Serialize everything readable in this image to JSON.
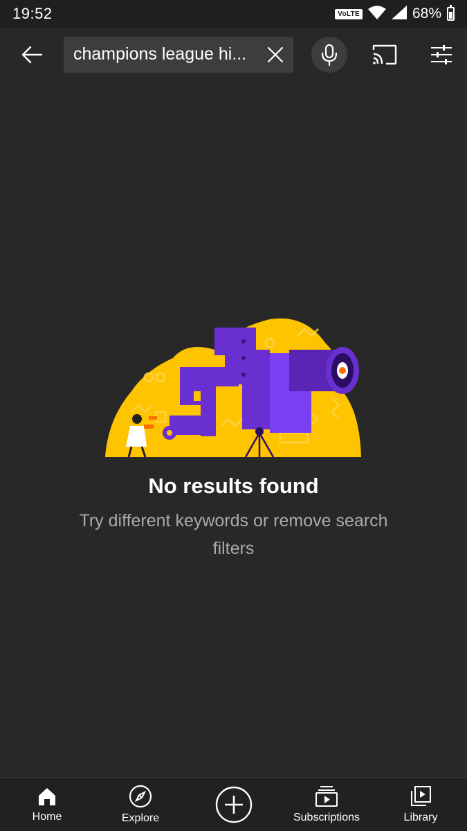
{
  "status_bar": {
    "time": "19:52",
    "network_badge": "VoLTE",
    "battery": "68%",
    "icons": [
      "wifi-icon",
      "signal-icon",
      "battery-icon"
    ]
  },
  "search": {
    "query": "champions league hi...",
    "icons": {
      "back": "back-arrow-icon",
      "clear": "close-icon",
      "mic": "microphone-icon",
      "cast": "cast-icon",
      "filter": "filter-sliders-icon"
    }
  },
  "empty_state": {
    "title": "No results found",
    "subtitle": "Try different keywords or remove search filters",
    "illustration": "telescope-illustration"
  },
  "bottom_nav": {
    "items": [
      {
        "label": "Home",
        "icon": "home-icon"
      },
      {
        "label": "Explore",
        "icon": "compass-icon"
      },
      {
        "label": "",
        "icon": "create-plus-icon"
      },
      {
        "label": "Subscriptions",
        "icon": "subscriptions-icon"
      },
      {
        "label": "Library",
        "icon": "library-icon"
      }
    ]
  },
  "colors": {
    "background": "#282828",
    "status_bar": "#1f1f1f",
    "search_field": "#3d3d3d",
    "illustration_yellow": "#ffc400",
    "illustration_purple": "#6a2fd0",
    "accent_orange": "#ff6d00",
    "subtitle_text": "#aaaaaa"
  }
}
